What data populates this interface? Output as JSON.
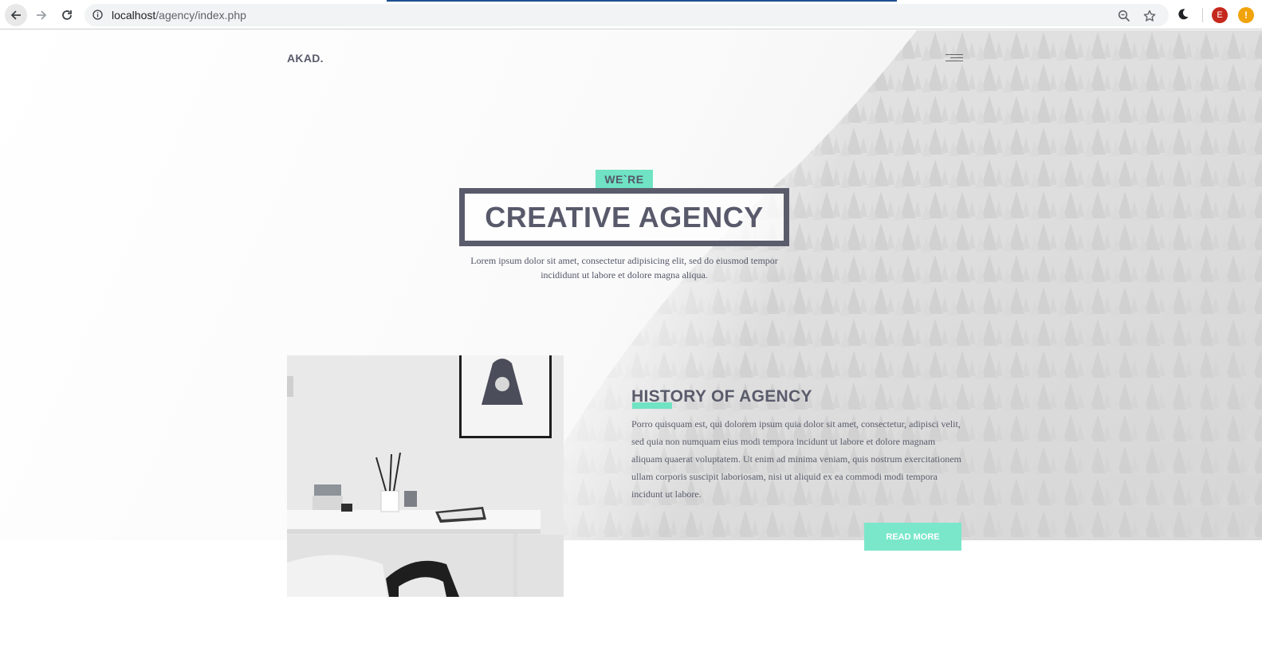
{
  "browser": {
    "url_host": "localhost",
    "url_path": "/agency/index.php",
    "icons": [
      "back-icon",
      "forward-icon",
      "reload-icon",
      "info-icon",
      "zoom-icon",
      "star-icon",
      "moon-icon"
    ],
    "extension_e_letter": "E",
    "extension_o_letter": "!"
  },
  "site": {
    "logo": "AKAD.",
    "hero": {
      "badge": "WE`RE",
      "title": "CREATIVE AGENCY",
      "description": "Lorem ipsum dolor sit amet, consectetur adipisicing elit, sed do eiusmod tempor incididunt ut labore et dolore magna aliqua."
    },
    "history": {
      "title": "HISTORY OF AGENCY",
      "text": "Porro quisquam est, qui dolorem ipsum quia dolor sit amet, consectetur, adipisci velit, sed quia non numquam eius modi tempora incidunt ut labore et dolore magnam aliquam quaerat voluptatem. Ut enim ad minima veniam, quis nostrum exercitationem ullam corporis suscipit laboriosam, nisi ut aliquid ex ea commodi modi tempora incidunt ut labore.",
      "button": "READ MORE"
    }
  },
  "colors": {
    "accent": "#6fe3c3",
    "text_dark": "#585a6b"
  }
}
